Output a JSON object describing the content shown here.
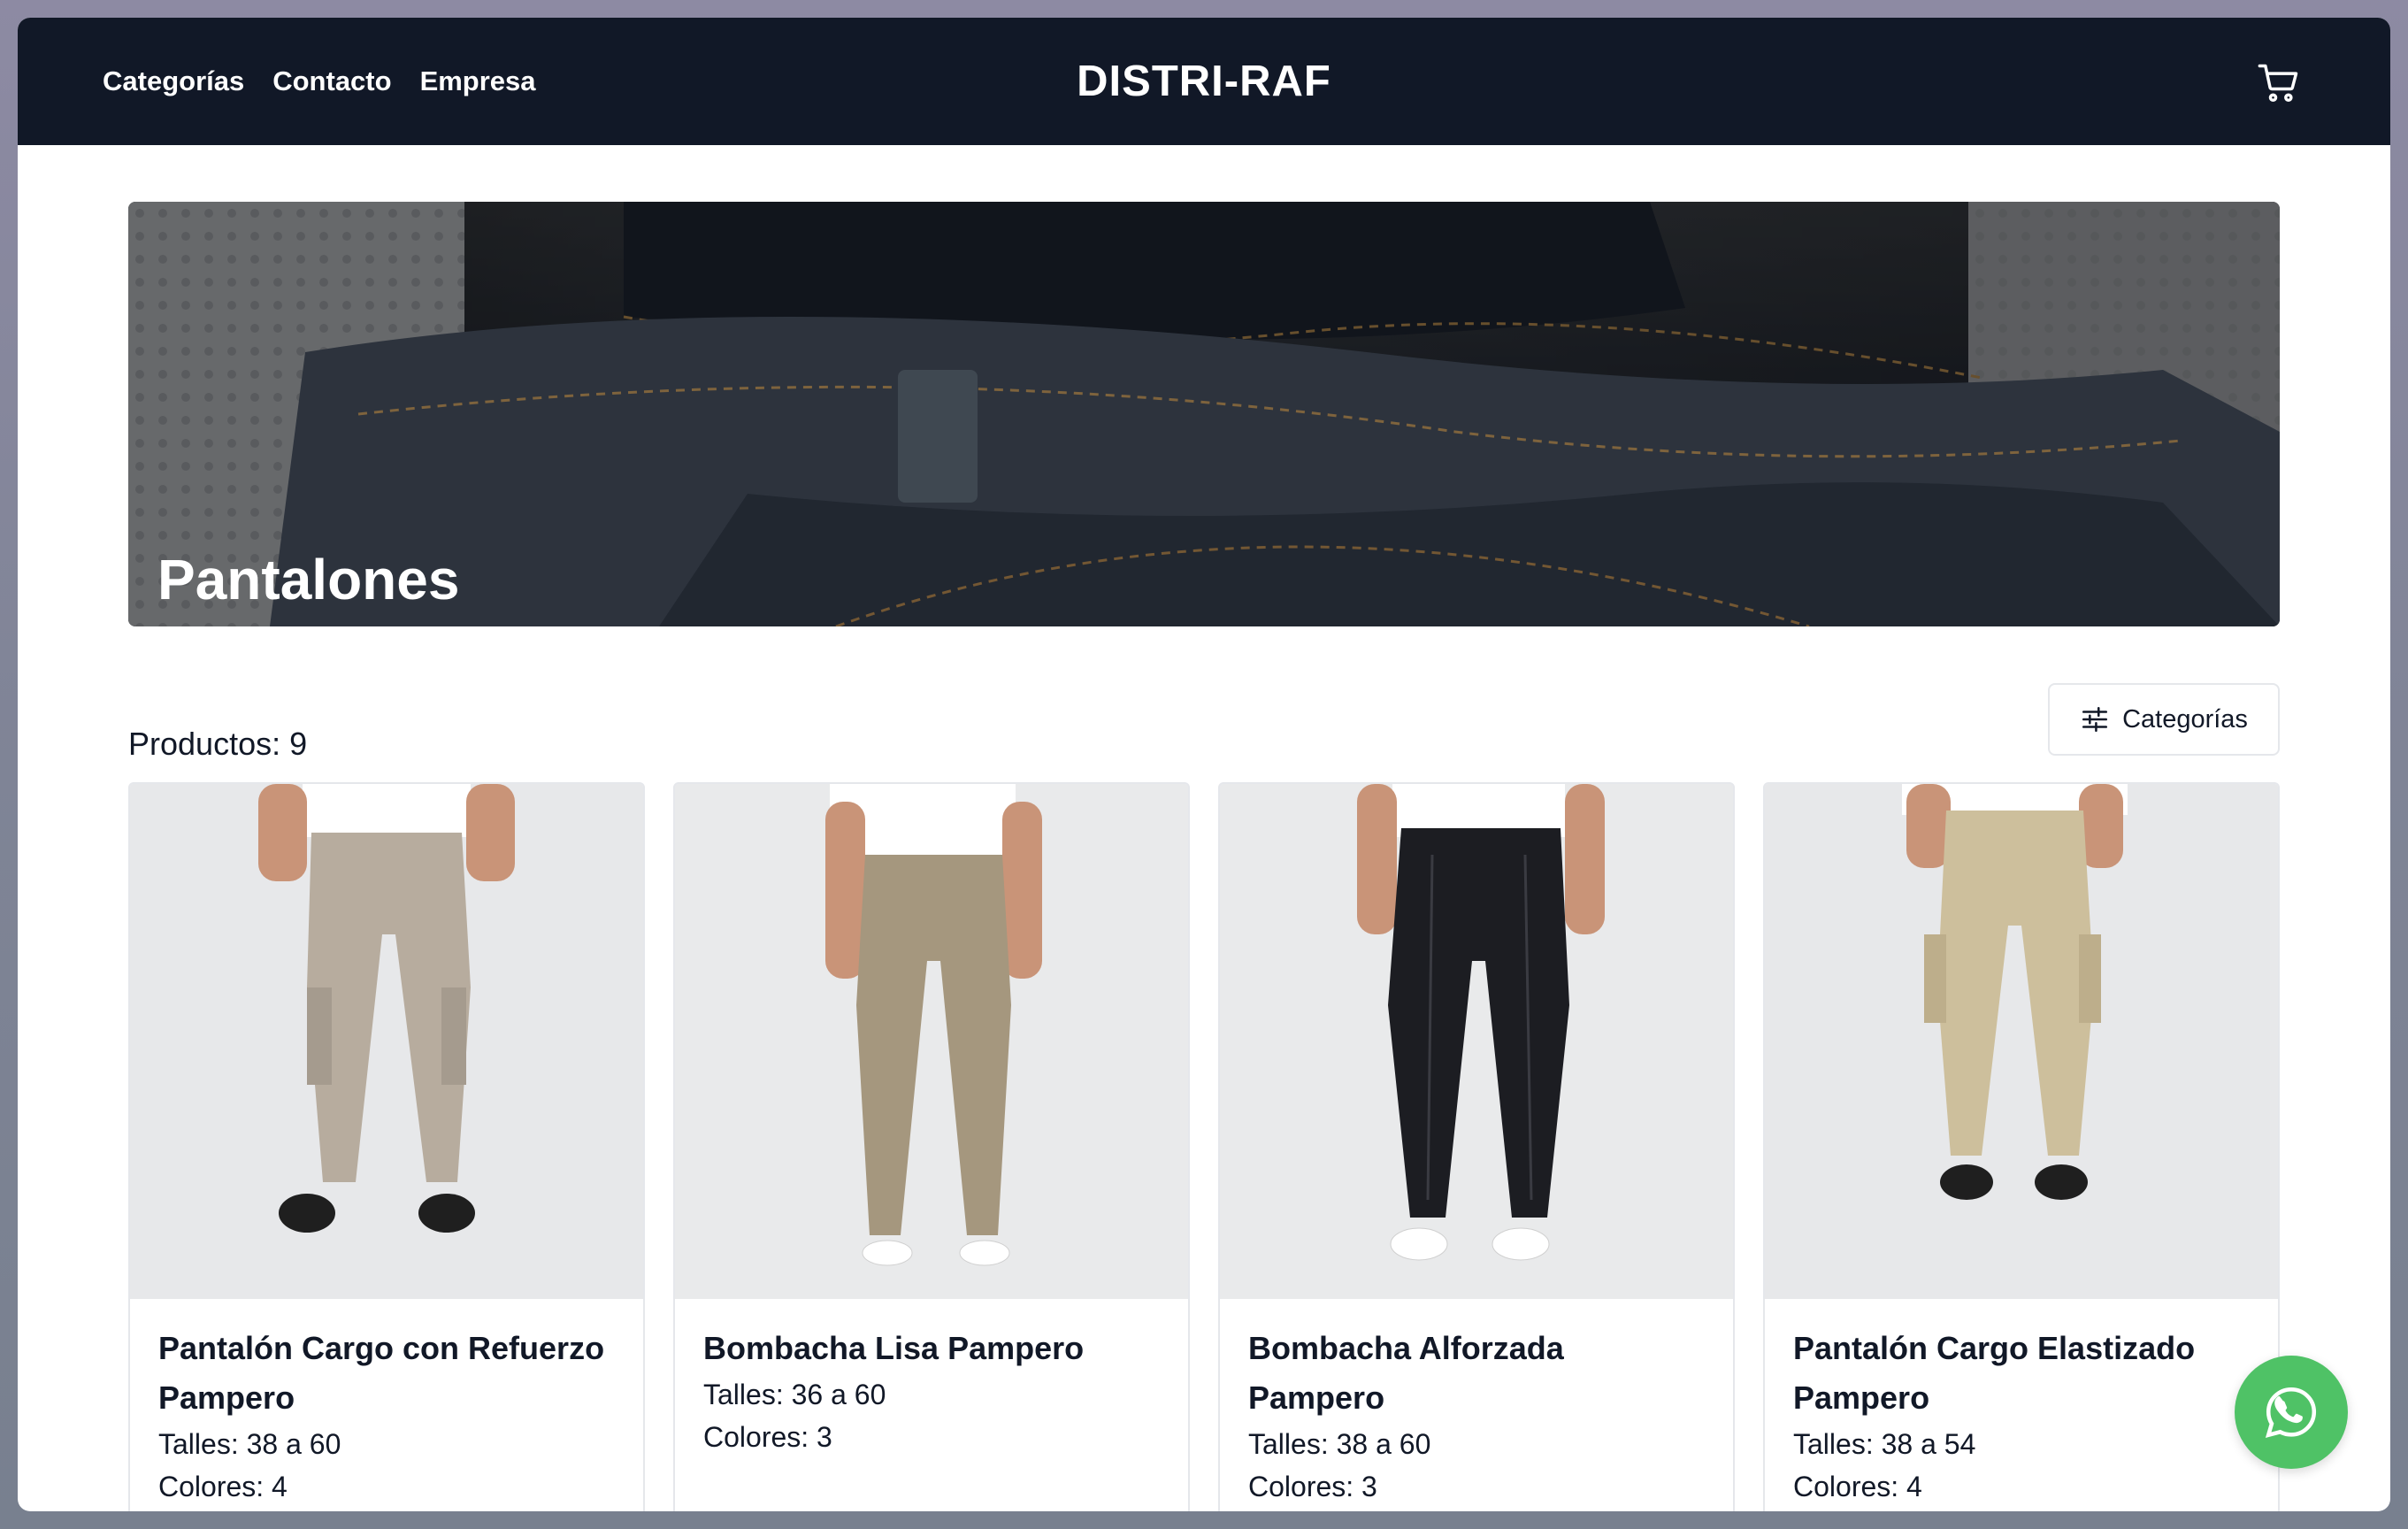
{
  "nav": {
    "links": [
      "Categorías",
      "Contacto",
      "Empresa"
    ],
    "brand": "DISTRI-RAF",
    "cart_icon": "shopping-cart-icon"
  },
  "hero": {
    "title": "Pantalones"
  },
  "toolbar": {
    "count_label": "Productos: 9",
    "categories_button": "Categorías",
    "filter_icon": "sliders-icon"
  },
  "products": [
    {
      "name": "Pantalón Cargo con Refuerzo Pampero",
      "sizes": "Talles: 38 a 60",
      "colors": "Colores: 4"
    },
    {
      "name": "Bombacha Lisa Pampero",
      "sizes": "Talles: 36 a 60",
      "colors": "Colores: 3"
    },
    {
      "name": "Bombacha Alforzada Pampero",
      "sizes": "Talles: 38 a 60",
      "colors": "Colores: 3"
    },
    {
      "name": "Pantalón Cargo Elastizado Pampero",
      "sizes": "Talles: 38 a 54",
      "colors": "Colores: 4"
    }
  ],
  "colors": {
    "navbar": "#111827",
    "whatsapp": "#4fc266"
  }
}
